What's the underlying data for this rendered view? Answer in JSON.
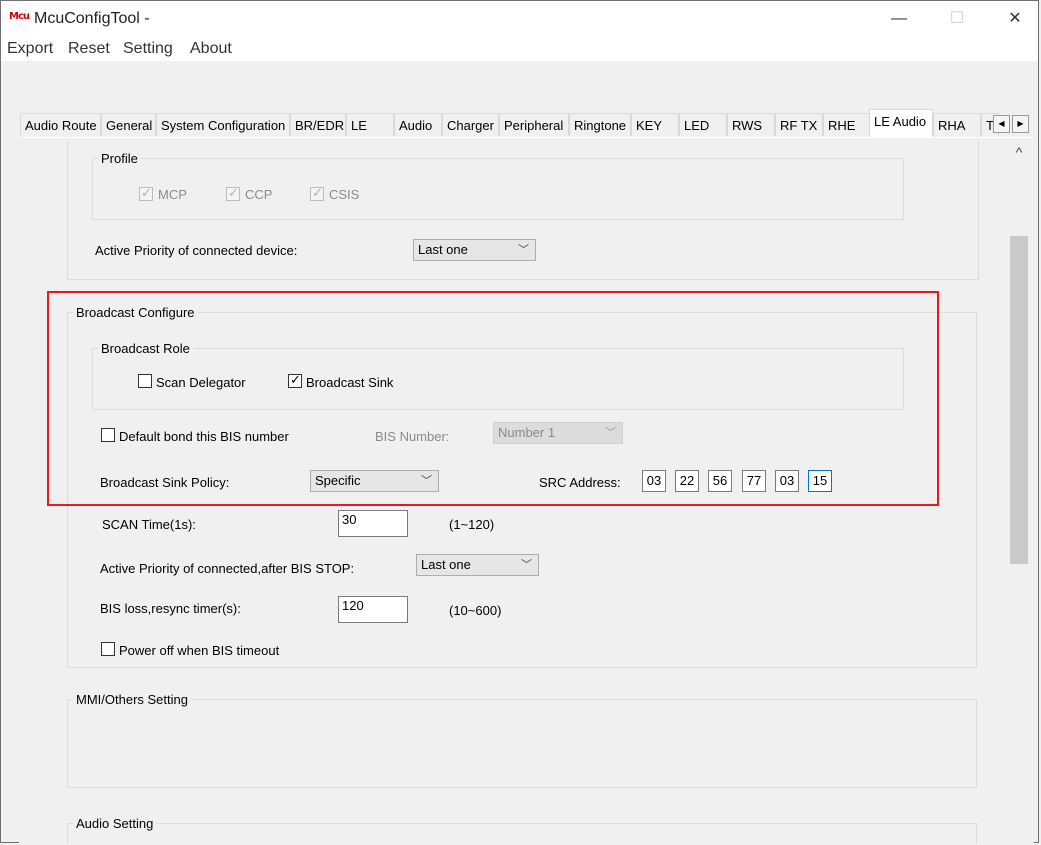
{
  "window": {
    "logo": "Mcu",
    "title": "McuConfigTool -",
    "minimize": "—",
    "maximize": "☐",
    "close": "✕"
  },
  "menu": [
    "Export",
    "Reset",
    "Setting",
    "About"
  ],
  "tabs": [
    "Audio Route",
    "General",
    "System Configuration",
    "BR/EDR",
    "LE",
    "Audio",
    "Charger",
    "Peripheral",
    "Ringtone",
    "KEY",
    "LED",
    "RWS",
    "RF TX",
    "RHE",
    "LE Audio",
    "RHA",
    "T"
  ],
  "active_tab": "LE Audio",
  "tab_scroll": {
    "left": "◀",
    "right": "▶"
  },
  "scrollbar": {
    "up": "^"
  },
  "profile": {
    "label": "Profile",
    "mcp": "MCP",
    "ccp": "CCP",
    "csis": "CSIS",
    "check_mark": "✓"
  },
  "active_priority": {
    "label": "Active Priority of connected device:",
    "value": "Last one"
  },
  "broadcast": {
    "label": "Broadcast Configure",
    "role_label": "Broadcast Role",
    "scan_delegator": "Scan Delegator",
    "broadcast_sink": "Broadcast Sink",
    "broadcast_sink_checked": "✓",
    "default_bond": "Default bond this BIS number",
    "bis_number_label": "BIS Number:",
    "bis_number_value": "Number 1",
    "sink_policy_label": "Broadcast Sink Policy:",
    "sink_policy_value": "Specific",
    "src_address_label": "SRC Address:",
    "src_address": [
      "03",
      "22",
      "56",
      "77",
      "03",
      "15"
    ],
    "scan_time_label": "SCAN Time(1s):",
    "scan_time_value": "30",
    "scan_time_range": "(1~120)",
    "active_priority_bis_label": "Active Priority of connected,after BIS STOP:",
    "active_priority_bis_value": "Last one",
    "bis_loss_label": "BIS loss,resync timer(s):",
    "bis_loss_value": "120",
    "bis_loss_range": "(10~600)",
    "power_off_label": "Power off when BIS timeout"
  },
  "mmi": {
    "label": "MMI/Others Setting"
  },
  "audio_setting": {
    "label": "Audio Setting"
  },
  "combo_arrow": "﹀",
  "highlight_color": "#e8191e"
}
